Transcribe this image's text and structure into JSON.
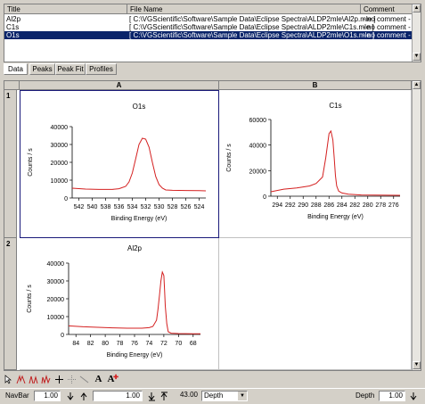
{
  "file_list": {
    "columns": {
      "title": "Title",
      "file_name": "File Name",
      "comment": "Comment"
    },
    "rows": [
      {
        "title": "Al2p",
        "file_name": "[ C:\\VGScientific\\Software\\Sample Data\\Eclipse Spectra\\ALDP2mle\\Al2p.mle ]",
        "comment": "- no comment -",
        "selected": false
      },
      {
        "title": "C1s",
        "file_name": "[ C:\\VGScientific\\Software\\Sample Data\\Eclipse Spectra\\ALDP2mle\\C1s.mle ]",
        "comment": "- no comment -",
        "selected": false
      },
      {
        "title": "O1s",
        "file_name": "[ C:\\VGScientific\\Software\\Sample Data\\Eclipse Spectra\\ALDP2mle\\O1s.mle ]",
        "comment": "- no comment -",
        "selected": true
      }
    ]
  },
  "tabs": [
    {
      "label": "Data",
      "active": true
    },
    {
      "label": "Peaks",
      "active": false
    },
    {
      "label": "Peak Fit",
      "active": false
    },
    {
      "label": "Profiles",
      "active": false
    }
  ],
  "grid": {
    "col_headers": [
      "A",
      "B"
    ],
    "row_headers": [
      "1",
      "2"
    ]
  },
  "chart_data": [
    {
      "type": "line",
      "title": "O1s",
      "xlabel": "Binding Energy (eV)",
      "ylabel": "Counts / s",
      "xlim": [
        543,
        523
      ],
      "ylim": [
        0,
        40000
      ],
      "xticks": [
        "542",
        "540",
        "538",
        "536",
        "534",
        "532",
        "530",
        "528",
        "526",
        "524"
      ],
      "yticks": [
        "0",
        "10000",
        "20000",
        "30000",
        "40000"
      ],
      "line_color": "#d42020",
      "x": [
        543,
        541,
        539,
        537,
        536,
        535,
        534.5,
        534,
        533.5,
        533,
        532.5,
        532,
        531.5,
        531,
        530.5,
        530,
        529.5,
        529,
        528,
        526,
        524,
        523
      ],
      "y": [
        5500,
        5000,
        4800,
        4800,
        5200,
        6500,
        9000,
        14000,
        22000,
        30000,
        33500,
        33000,
        28500,
        20000,
        12000,
        7500,
        5500,
        4500,
        4300,
        4200,
        4100,
        4000
      ]
    },
    {
      "type": "line",
      "title": "C1s",
      "xlabel": "Binding Energy (eV)",
      "ylabel": "Counts / s",
      "xlim": [
        295,
        275
      ],
      "ylim": [
        0,
        60000
      ],
      "xticks": [
        "294",
        "292",
        "290",
        "288",
        "286",
        "284",
        "282",
        "280",
        "278",
        "276"
      ],
      "yticks": [
        "0",
        "20000",
        "40000",
        "60000"
      ],
      "line_color": "#d42020",
      "x": [
        295,
        293,
        291,
        289,
        288,
        287,
        286.5,
        286,
        285.7,
        285.4,
        285.2,
        285,
        284.8,
        284.5,
        284,
        283,
        281,
        279,
        277,
        275
      ],
      "y": [
        3500,
        5500,
        6500,
        8000,
        10000,
        15000,
        30000,
        49000,
        51000,
        44000,
        30000,
        16000,
        8000,
        4000,
        2500,
        1500,
        1000,
        900,
        800,
        700
      ]
    },
    {
      "type": "line",
      "title": "Al2p",
      "xlabel": "Binding Energy (eV)",
      "ylabel": "Counts / s",
      "xlim": [
        85,
        67
      ],
      "ylim": [
        0,
        40000
      ],
      "xticks": [
        "84",
        "82",
        "80",
        "78",
        "76",
        "74",
        "72",
        "70",
        "68"
      ],
      "yticks": [
        "0",
        "10000",
        "20000",
        "30000",
        "40000"
      ],
      "line_color": "#d42020",
      "x": [
        85,
        83,
        81,
        79,
        77,
        75,
        74,
        73.5,
        73,
        72.8,
        72.6,
        72.4,
        72.2,
        72,
        71.9,
        71.8,
        71.6,
        71.4,
        71,
        70,
        68,
        67
      ],
      "y": [
        4800,
        4300,
        4000,
        3700,
        3500,
        3500,
        3800,
        4500,
        8000,
        14000,
        22000,
        30000,
        35000,
        33000,
        25000,
        16000,
        6000,
        1500,
        700,
        500,
        400,
        400
      ]
    }
  ],
  "toolbar": {
    "icons": [
      "select-arrow-icon",
      "peak-a-icon",
      "peak-b-icon",
      "peak-c-icon",
      "plus-icon",
      "dotted-grid-icon",
      "line-icon",
      "text-a-icon",
      "text-a-red-icon"
    ]
  },
  "status": {
    "navbar_label": "NavBar",
    "navbar_value": "1.00",
    "position_value": "1.00",
    "right_value": "43.00",
    "dropdown_value": "Depth",
    "depth_label": "Depth",
    "depth_value": "1.00"
  }
}
